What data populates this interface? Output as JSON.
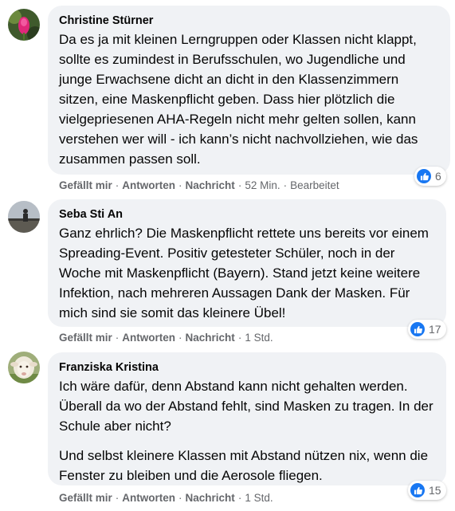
{
  "comments": [
    {
      "author": "Christine Stürner",
      "paragraphs": [
        "Da es ja mit kleinen Lerngruppen oder Klassen nicht klappt, sollte es zumindest in Berufsschulen, wo Jugendliche und junge Erwachsene dicht an dicht in den Klassenzimmern sitzen, eine Maskenpflicht geben. Dass hier plötzlich die vielgepriesenen AHA-Regeln nicht mehr gelten sollen, kann verstehen wer will - ich kann’s nicht nachvollziehen, wie das zusammen passen soll."
      ],
      "reaction_count": "6",
      "like_label": "Gefällt mir",
      "reply_label": "Antworten",
      "message_label": "Nachricht",
      "time": "52 Min.",
      "edited": "Bearbeitet",
      "avatar_icon": "pink-flower-avatar"
    },
    {
      "author": "Seba Sti An",
      "paragraphs": [
        "Ganz ehrlich? Die Maskenpflicht rettete uns bereits vor einem Spreading-Event. Positiv getesteter Schüler, noch in der Woche mit Maskenpflicht (Bayern). Stand jetzt keine weitere Infektion, nach mehreren Aussagen Dank der Masken. Für mich sind sie somit das kleinere Übel!"
      ],
      "reaction_count": "17",
      "like_label": "Gefällt mir",
      "reply_label": "Antworten",
      "message_label": "Nachricht",
      "time": "1 Std.",
      "avatar_icon": "person-landscape-avatar"
    },
    {
      "author": "Franziska Kristina",
      "paragraphs": [
        "Ich wäre dafür, denn Abstand kann nicht gehalten werden. Überall da wo der Abstand fehlt, sind Masken zu tragen. In der Schule aber nicht?",
        "Und selbst kleinere Klassen mit Abstand nützen nix, wenn die Fenster zu bleiben und die Aerosole fliegen."
      ],
      "reaction_count": "15",
      "like_label": "Gefällt mir",
      "reply_label": "Antworten",
      "message_label": "Nachricht",
      "time": "1 Std.",
      "avatar_icon": "sheep-avatar"
    }
  ],
  "colors": {
    "bubble": "#f0f2f5",
    "like_blue": "#1877f2",
    "meta_gray": "#65676b"
  }
}
